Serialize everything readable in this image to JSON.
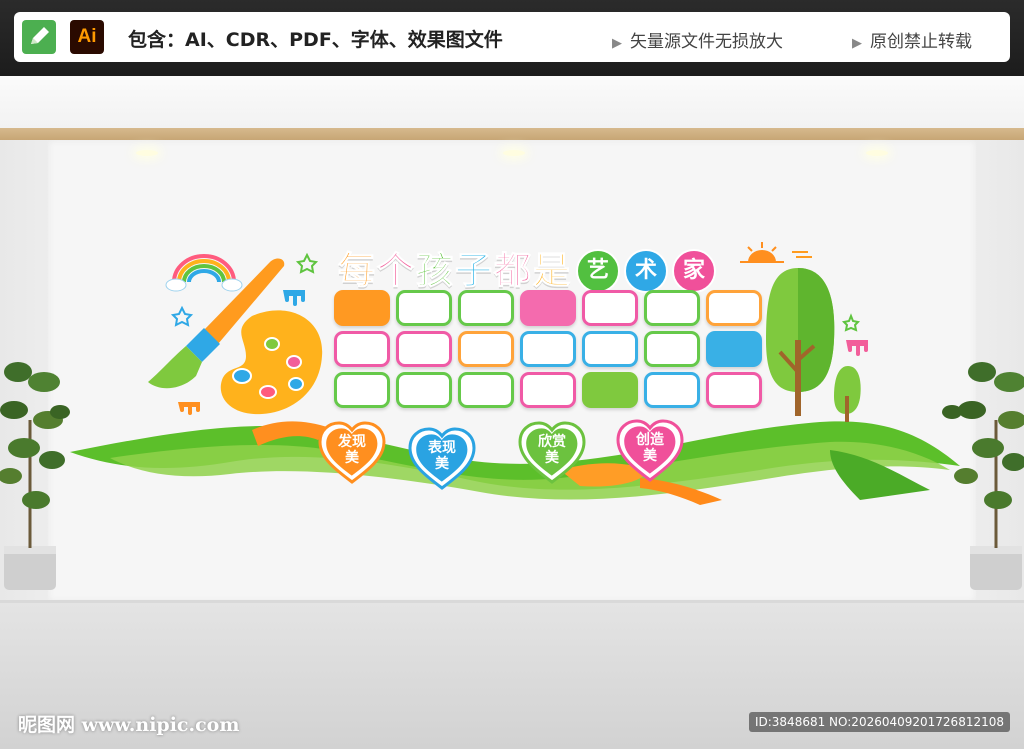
{
  "banner": {
    "main_text": "包含：AI、CDR、PDF、字体、效果图文件",
    "vector_text": "矢量源文件无损放大",
    "original_text": "原创禁止转载",
    "ai_badge": "Ai"
  },
  "heading": {
    "chars": [
      {
        "t": "每",
        "color": "#ff9b1e"
      },
      {
        "t": "个",
        "color": "#f25e9a"
      },
      {
        "t": "孩",
        "color": "#5fc43f"
      },
      {
        "t": "子",
        "color": "#26b3e8"
      },
      {
        "t": "都",
        "color": "#f25e9a"
      },
      {
        "t": "是",
        "color": "#ffb21c"
      }
    ],
    "circles": [
      {
        "t": "艺",
        "color": "#52c040"
      },
      {
        "t": "术",
        "color": "#2fa8e6"
      },
      {
        "t": "家",
        "color": "#f0509a"
      }
    ]
  },
  "frames": {
    "rows": [
      [
        "#ff9922*",
        "#66c94a",
        "#66c94a",
        "#f46bae*",
        "#f05aa6",
        "#66c94a",
        "#ffa33a"
      ],
      [
        "#f05aa6",
        "#f05aa6",
        "#ffa33a",
        "#39b0e6",
        "#39b0e6",
        "#66c94a",
        "#39b0e6*"
      ],
      [
        "#66c94a",
        "#66c94a",
        "#66c94a",
        "#f05aa6",
        "#7fc93e*",
        "#39b0e6",
        "#f05aa6"
      ]
    ]
  },
  "hearts": [
    {
      "line1": "发现",
      "line2": "美",
      "color": "#ff8f1f"
    },
    {
      "line1": "表现",
      "line2": "美",
      "color": "#2aa3e2"
    },
    {
      "line1": "欣赏",
      "line2": "美",
      "color": "#6cc23f"
    },
    {
      "line1": "创造",
      "line2": "美",
      "color": "#f0509a"
    }
  ],
  "watermark": {
    "left": "昵图网 www.nipic.com",
    "right": "ID:3848681 NO:20260409201726812108"
  }
}
